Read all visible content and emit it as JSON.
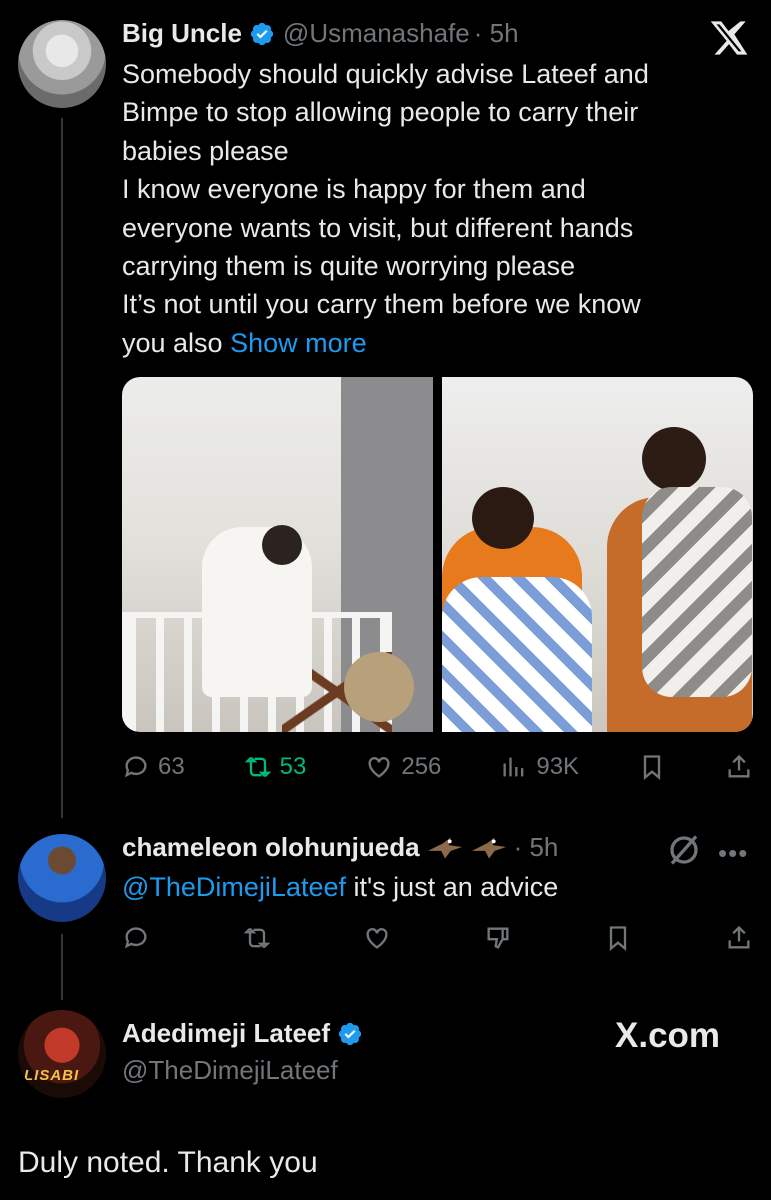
{
  "tweet1": {
    "name": "Big Uncle",
    "handle": "@Usmanashafe",
    "time": "· 5h",
    "text": "Somebody should quickly advise Lateef and\nBimpe to stop allowing people to carry their\nbabies please\nI know everyone is happy for them and\neveryone wants to visit, but different hands\ncarrying them is quite worrying please\nIt’s not until you carry them before we know\nyou also ",
    "show_more": "Show more",
    "stats": {
      "replies": "63",
      "reposts": "53",
      "likes": "256",
      "views": "93K"
    }
  },
  "tweet2": {
    "name": "chameleon olohunjueda",
    "time": "· 5h",
    "mention": "@TheDimejiLateef",
    "text": " it's just an advice"
  },
  "tweet3": {
    "name": "Adedimeji Lateef",
    "handle": "@TheDimejiLateef",
    "avatar_text": "LISABI",
    "text": "Duly noted. Thank you"
  },
  "branding": {
    "xcom": "X.com"
  },
  "colors": {
    "accent": "#1d9bf0",
    "repost_active": "#00ba7c",
    "muted": "#71767b",
    "background": "#000000"
  },
  "icons": [
    "x-logo-icon",
    "verified-badge-icon",
    "reply-icon",
    "repost-icon",
    "like-icon",
    "views-icon",
    "bookmark-icon",
    "share-icon",
    "grok-icon",
    "more-icon",
    "downvote-icon"
  ]
}
